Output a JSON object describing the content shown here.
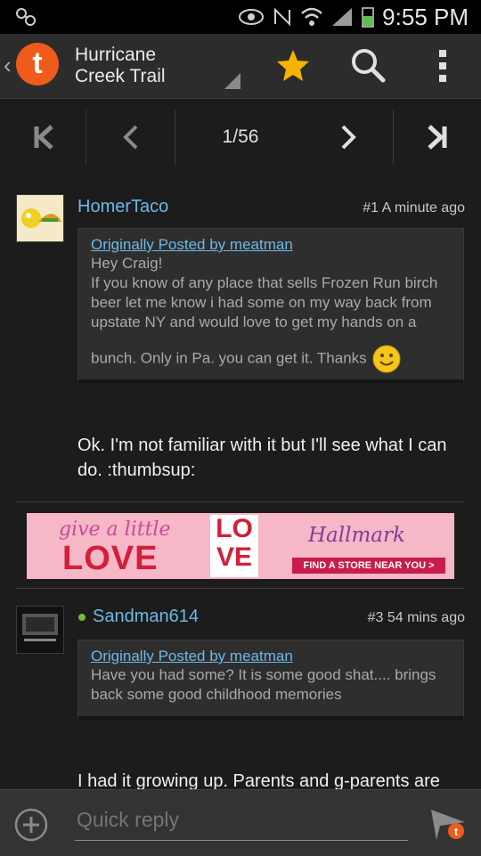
{
  "status_bar": {
    "time": "9:55 PM",
    "icons": [
      "voicemail-icon",
      "eye-icon",
      "nfc-icon",
      "wifi-icon",
      "signal-icon",
      "battery-icon"
    ]
  },
  "app_bar": {
    "thread_title_line1": "Hurricane",
    "thread_title_line2": "Creek Trail",
    "brand_letter": "t",
    "accent_color": "#f05a1a",
    "star_color": "#f6b400",
    "icons": [
      "back-chevron-icon",
      "tapatalk-logo",
      "star-icon",
      "search-icon",
      "overflow-menu-icon"
    ]
  },
  "pager": {
    "current": "1",
    "total": "56",
    "icons": [
      "first-page-icon",
      "prev-page-icon",
      "next-page-icon",
      "last-page-icon"
    ]
  },
  "posts": [
    {
      "author": "HomerTaco",
      "meta": "#1  A minute ago",
      "quote_header": "Originally Posted by meatman",
      "quote_lines": [
        "Hey Craig!",
        "If you know of any place that sells Frozen Run birch",
        "beer let me know i had some on my way back from",
        "upstate NY and would love to get my hands on a",
        "bunch. Only in Pa. you can get it. Thanks"
      ],
      "body": "Ok. I'm not familiar with it but I'll see what I can do. :thumbsup:"
    },
    {
      "author": "Sandman614",
      "meta": "#3  54 mins ago",
      "quote_header": "Originally Posted by meatman",
      "quote_lines": [
        "Have you had some? It is some good shat.... brings",
        "back some good childhood memories"
      ],
      "body_partial": "I had it growing up. Parents and g-parents are"
    }
  ],
  "ad": {
    "tag_line": "give a little",
    "headline": "LOVE",
    "box_top": "LO",
    "box_bottom": "VE",
    "brand": "Hallmark",
    "cta": "FIND A STORE NEAR YOU >"
  },
  "reply_bar": {
    "placeholder": "Quick reply",
    "icons": [
      "add-attachment-icon",
      "send-icon"
    ]
  }
}
